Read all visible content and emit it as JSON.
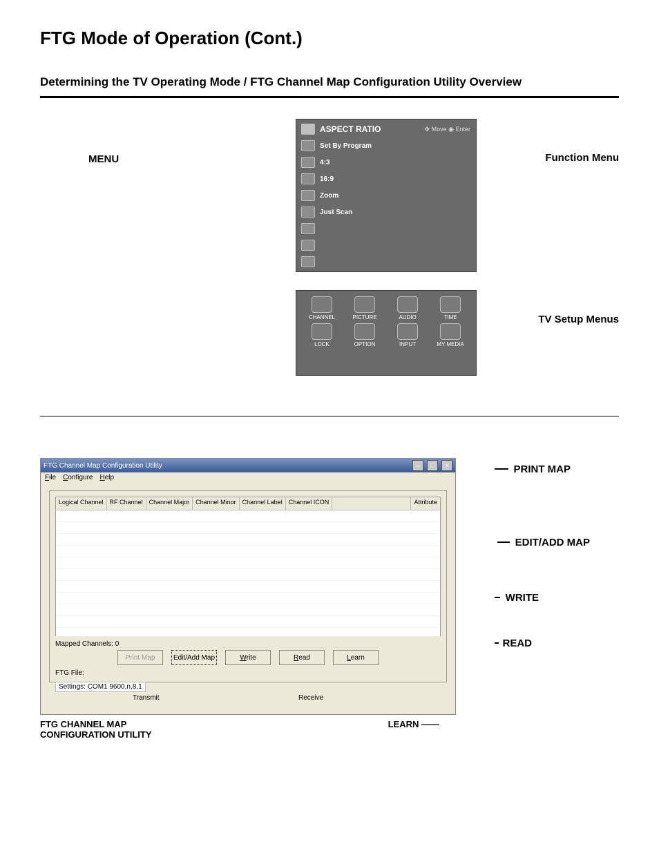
{
  "page": {
    "title": "FTG Mode of Operation (Cont.)",
    "subtitle": "Determining the TV Operating Mode / FTG Channel Map Configuration Utility Overview"
  },
  "tv_section": {
    "menu_label": "MENU",
    "function_menu_label": "Function Menu",
    "setup_menus_label": "TV Setup Menus",
    "aspect_box": {
      "title": "ASPECT RATIO",
      "hint_move": "Move",
      "hint_enter": "Enter",
      "items": [
        "Set By Program",
        "4:3",
        "16:9",
        "Zoom",
        "Just Scan"
      ]
    },
    "setup_box": {
      "items": [
        "CHANNEL",
        "PICTURE",
        "AUDIO",
        "TIME",
        "LOCK",
        "OPTION",
        "INPUT",
        "MY MEDIA"
      ]
    }
  },
  "utility": {
    "window_title": "FTG Channel Map Configuration Utility",
    "menubar": {
      "file": "File",
      "configure": "Configure",
      "help": "Help"
    },
    "columns": [
      "Logical Channel",
      "RF Channel",
      "Channel Major",
      "Channel Minor",
      "Channel Label",
      "Channel ICON"
    ],
    "column_last": "Attribute",
    "mapped_label": "Mapped Channels: 0",
    "ftg_file_label": "FTG File:",
    "settings_label": "Settings: COM1 9600,n,8,1",
    "transmit_label": "Transmit",
    "receive_label": "Receive",
    "buttons": {
      "print": "Print Map",
      "edit": "Edit/Add Map",
      "write": "Write",
      "read": "Read",
      "learn": "Learn"
    },
    "callouts": {
      "print": "PRINT MAP",
      "edit": "EDIT/ADD MAP",
      "write": "WRITE",
      "read": "READ",
      "learn": "LEARN"
    },
    "bottom_left_label": "FTG CHANNEL MAP\nCONFIGURATION UTILITY",
    "bottom_right_label": "LEARN"
  }
}
